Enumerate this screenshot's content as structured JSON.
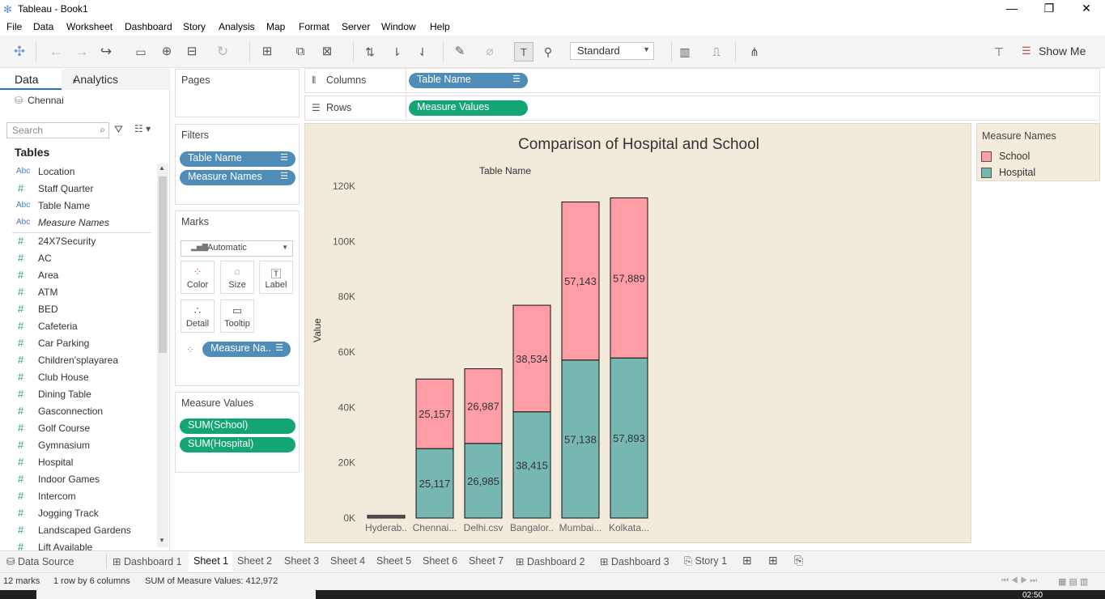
{
  "window": {
    "title": "Tableau - Book1"
  },
  "menu": [
    "File",
    "Data",
    "Worksheet",
    "Dashboard",
    "Story",
    "Analysis",
    "Map",
    "Format",
    "Server",
    "Window",
    "Help"
  ],
  "toolbar": {
    "fit_select": "Standard",
    "show_me": "Show Me"
  },
  "sidebar": {
    "tab_data": "Data",
    "tab_analytics": "Analytics",
    "datasource": "Chennai",
    "search_placeholder": "Search",
    "tables_heading": "Tables",
    "dimensions": [
      {
        "type": "Abc",
        "name": "Location"
      },
      {
        "type": "#",
        "name": "Staff Quarter"
      },
      {
        "type": "Abc",
        "name": "Table Name"
      },
      {
        "type": "Abc",
        "name": "Measure Names"
      }
    ],
    "measures": [
      "24X7Security",
      "AC",
      "Area",
      "ATM",
      "BED",
      "Cafeteria",
      "Car Parking",
      "Children'splayarea",
      "Club House",
      "Dining Table",
      "Gasconnection",
      "Golf Course",
      "Gymnasium",
      "Hospital",
      "Indoor Games",
      "Intercom",
      "Jogging Track",
      "Landscaped Gardens",
      "Lift Available"
    ]
  },
  "cards": {
    "pages_title": "Pages",
    "filters_title": "Filters",
    "filters": [
      "Table Name",
      "Measure Names"
    ],
    "marks_title": "Marks",
    "mark_type": "Automatic",
    "mark_buttons": [
      "Color",
      "Size",
      "Label",
      "Detail",
      "Tooltip"
    ],
    "color_pill": "Measure Na..",
    "measure_values_title": "Measure Values",
    "measure_values": [
      "SUM(School)",
      "SUM(Hospital)"
    ]
  },
  "shelves": {
    "columns_label": "Columns",
    "columns_pill": "Table Name",
    "rows_label": "Rows",
    "rows_pill": "Measure Values"
  },
  "chart_data": {
    "type": "bar",
    "stacked": true,
    "title": "Comparison of Hospital and School",
    "xlabel": "Table Name",
    "ylabel": "Value",
    "categories": [
      "Hyderab..",
      "Chennai...",
      "Delhi.csv",
      "Bangalor..",
      "Mumbai...",
      "Kolkata..."
    ],
    "series": [
      {
        "name": "Hospital",
        "color": "#76b7b2",
        "values": [
          500,
          25117,
          26985,
          38415,
          57138,
          57893
        ],
        "labels": [
          "",
          "25,117",
          "26,985",
          "38,415",
          "57,138",
          "57,893"
        ]
      },
      {
        "name": "School",
        "color": "#ff9da7",
        "values": [
          500,
          25157,
          26987,
          38534,
          57143,
          57889
        ],
        "labels": [
          "",
          "25,157",
          "26,987",
          "38,534",
          "57,143",
          "57,889"
        ]
      }
    ],
    "y_ticks": [
      "0K",
      "20K",
      "40K",
      "60K",
      "80K",
      "100K",
      "120K"
    ],
    "ylim": [
      0,
      120000
    ],
    "grid": false,
    "legend_position": "right"
  },
  "legend": {
    "title": "Measure Names",
    "items": [
      {
        "label": "School",
        "color": "#ff9da7"
      },
      {
        "label": "Hospital",
        "color": "#76b7b2"
      }
    ]
  },
  "bottom_tabs": [
    "Data Source",
    "Dashboard 1",
    "Sheet 1",
    "Sheet 2",
    "Sheet 3",
    "Sheet 4",
    "Sheet 5",
    "Sheet 6",
    "Sheet 7",
    "Dashboard 2",
    "Dashboard 3",
    "Story 1"
  ],
  "status": {
    "marks": "12 marks",
    "rows_cols": "1 row by 6 columns",
    "sum": "SUM of Measure Values: 412,972"
  },
  "clock": "02:50"
}
